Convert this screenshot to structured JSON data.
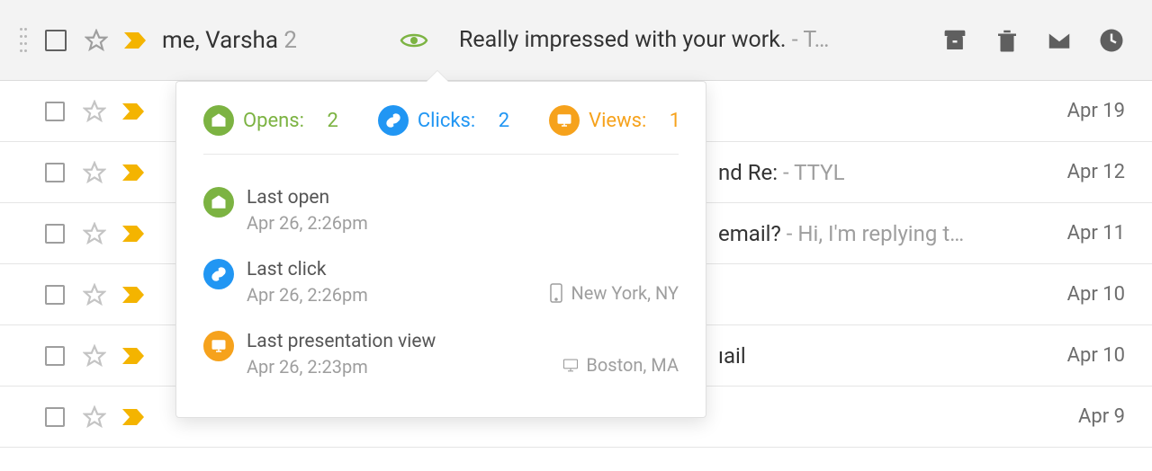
{
  "first_row": {
    "sender": "me, Varsha",
    "count": "2",
    "subject": "Really impressed with your work.",
    "snippet": "- T…"
  },
  "rows": [
    {
      "subject_fragment": "",
      "snippet": "",
      "date": "Apr 19"
    },
    {
      "subject_fragment": "nd Re:",
      "snippet": " - TTYL",
      "date": "Apr 12"
    },
    {
      "subject_fragment": " email?",
      "snippet": " - Hi, I'm replying t…",
      "date": "Apr 11"
    },
    {
      "subject_fragment": "",
      "snippet": "",
      "date": "Apr 10"
    },
    {
      "subject_fragment": "ıail",
      "snippet": "",
      "date": "Apr 10"
    },
    {
      "subject_fragment": "",
      "snippet": "",
      "date": "Apr 9"
    }
  ],
  "popover": {
    "opens_label": "Opens:",
    "opens_count": "2",
    "clicks_label": "Clicks:",
    "clicks_count": "2",
    "views_label": "Views:",
    "views_count": "1",
    "events": {
      "open": {
        "title": "Last open",
        "time": "Apr 26, 2:26pm"
      },
      "click": {
        "title": "Last click",
        "time": "Apr 26, 2:26pm",
        "location": "New York, NY"
      },
      "view": {
        "title": "Last presentation view",
        "time": "Apr 26, 2:23pm",
        "location": "Boston, MA"
      }
    }
  }
}
